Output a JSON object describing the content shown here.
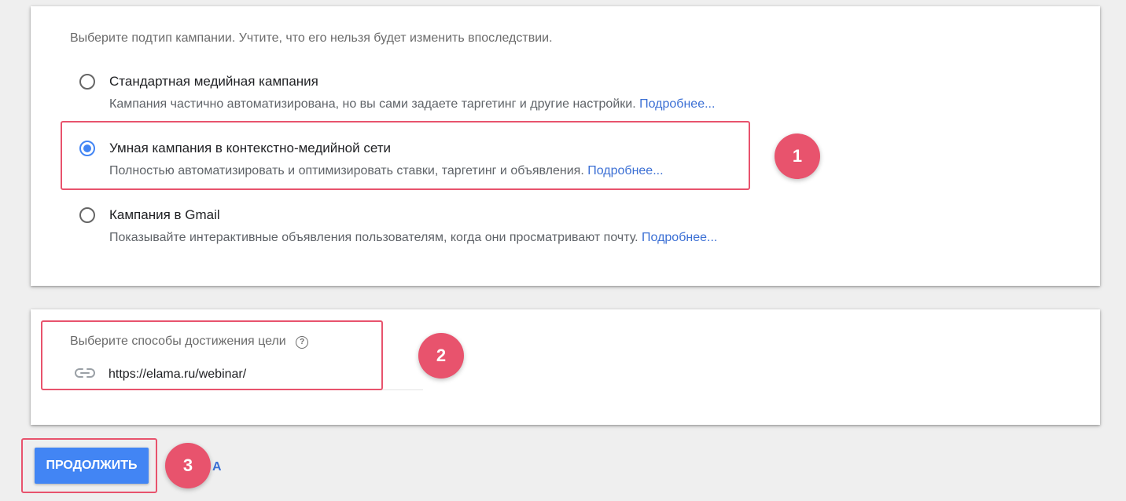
{
  "subtype_section": {
    "intro": "Выберите подтип кампании. Учтите, что его нельзя будет изменить впоследствии.",
    "options": [
      {
        "title": "Стандартная медийная кампания",
        "description": "Кампания частично автоматизирована, но вы сами задаете таргетинг и другие настройки.",
        "more": "Подробнее...",
        "selected": false
      },
      {
        "title": "Умная кампания в контекстно-медийной сети",
        "description": "Полностью автоматизировать и оптимизировать ставки, таргетинг и объявления.",
        "more": "Подробнее...",
        "selected": true
      },
      {
        "title": "Кампания в Gmail",
        "description": "Показывайте интерактивные объявления пользователям, когда они просматривают почту.",
        "more": "Подробнее...",
        "selected": false
      }
    ]
  },
  "goal_section": {
    "label": "Выберите способы достижения цели",
    "help_icon": "?",
    "url_value": "https://elama.ru/webinar/"
  },
  "footer": {
    "continue_label": "ПРОДОЛЖИТЬ",
    "cancel_partial": "А"
  },
  "badges": [
    "1",
    "2",
    "3"
  ],
  "colors": {
    "accent": "#4285f4",
    "highlight": "#e8536d",
    "link": "#3b6fd4"
  }
}
